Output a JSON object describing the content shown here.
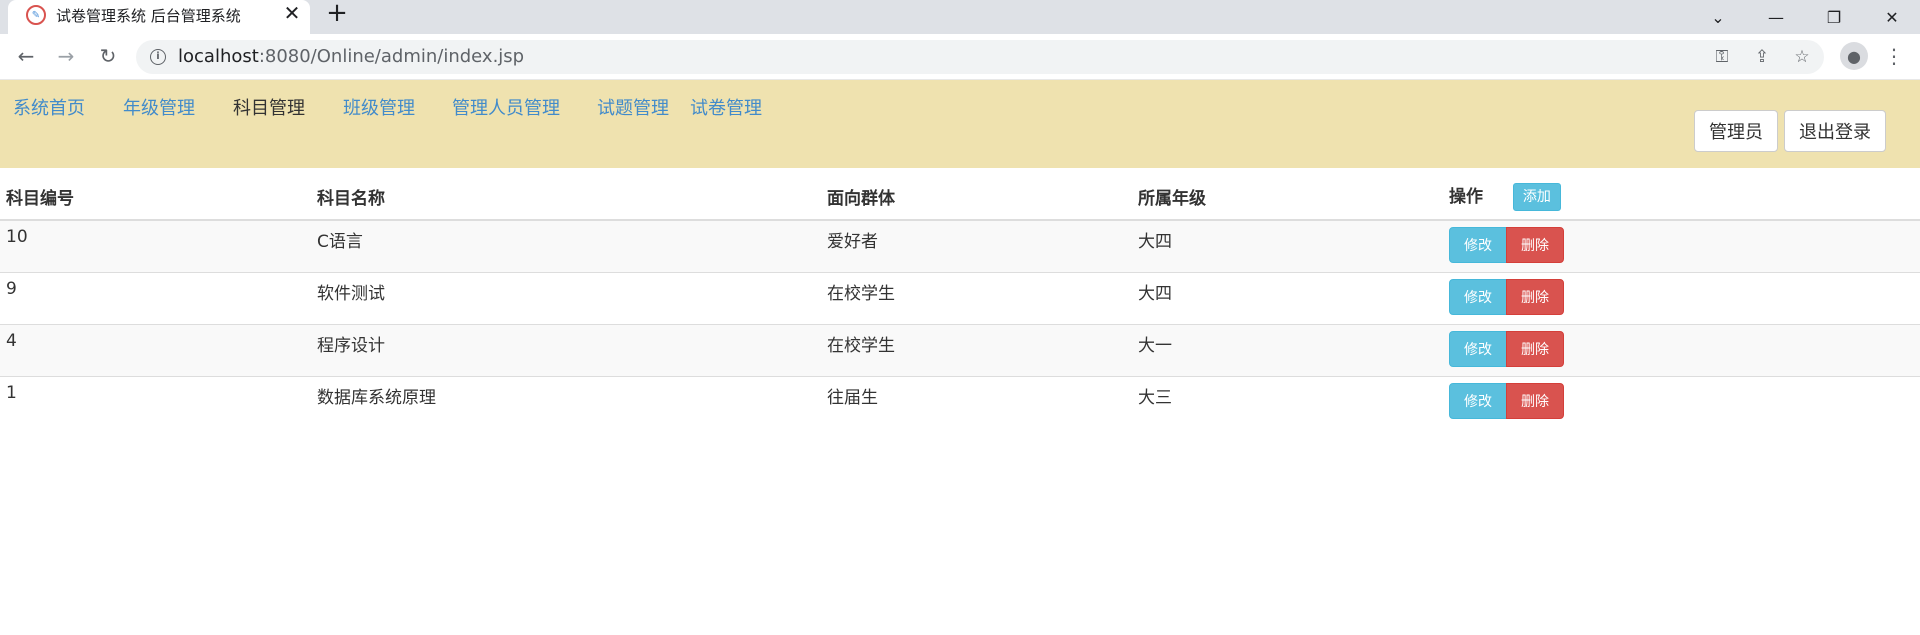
{
  "browser": {
    "tab_title": "试卷管理系统 后台管理系统",
    "url_host": "localhost",
    "url_rest": ":8080/Online/admin/index.jsp"
  },
  "nav": {
    "items": [
      "系统首页",
      "年级管理",
      "科目管理",
      "班级管理",
      "管理人员管理",
      "试题管理",
      "试卷管理"
    ],
    "active": "科目管理",
    "admin_button": "管理员",
    "logout_button": "退出登录"
  },
  "table": {
    "headers": [
      "科目编号",
      "科目名称",
      "面向群体",
      "所属年级",
      "操作"
    ],
    "add_label": "添加",
    "edit_label": "修改",
    "delete_label": "删除",
    "rows": [
      [
        "10",
        "C语言",
        "爱好者",
        "大四"
      ],
      [
        "9",
        "软件测试",
        "在校学生",
        "大四"
      ],
      [
        "4",
        "程序设计",
        "在校学生",
        "大一"
      ],
      [
        "1",
        "数据库系统原理",
        "往届生",
        "大三"
      ]
    ]
  },
  "icons": {
    "favicon": "app-favicon-icon",
    "back": "back-arrow-icon",
    "forward": "forward-arrow-icon",
    "reload": "reload-icon",
    "info": "site-info-icon",
    "key": "key-icon",
    "share": "share-icon",
    "star": "bookmark-star-icon",
    "profile": "profile-icon",
    "menu": "kebab-menu-icon"
  },
  "colors": {
    "nav_background": "#efe2af",
    "link": "#428bca",
    "info_button": "#5bc0de",
    "danger_button": "#d9534f"
  }
}
